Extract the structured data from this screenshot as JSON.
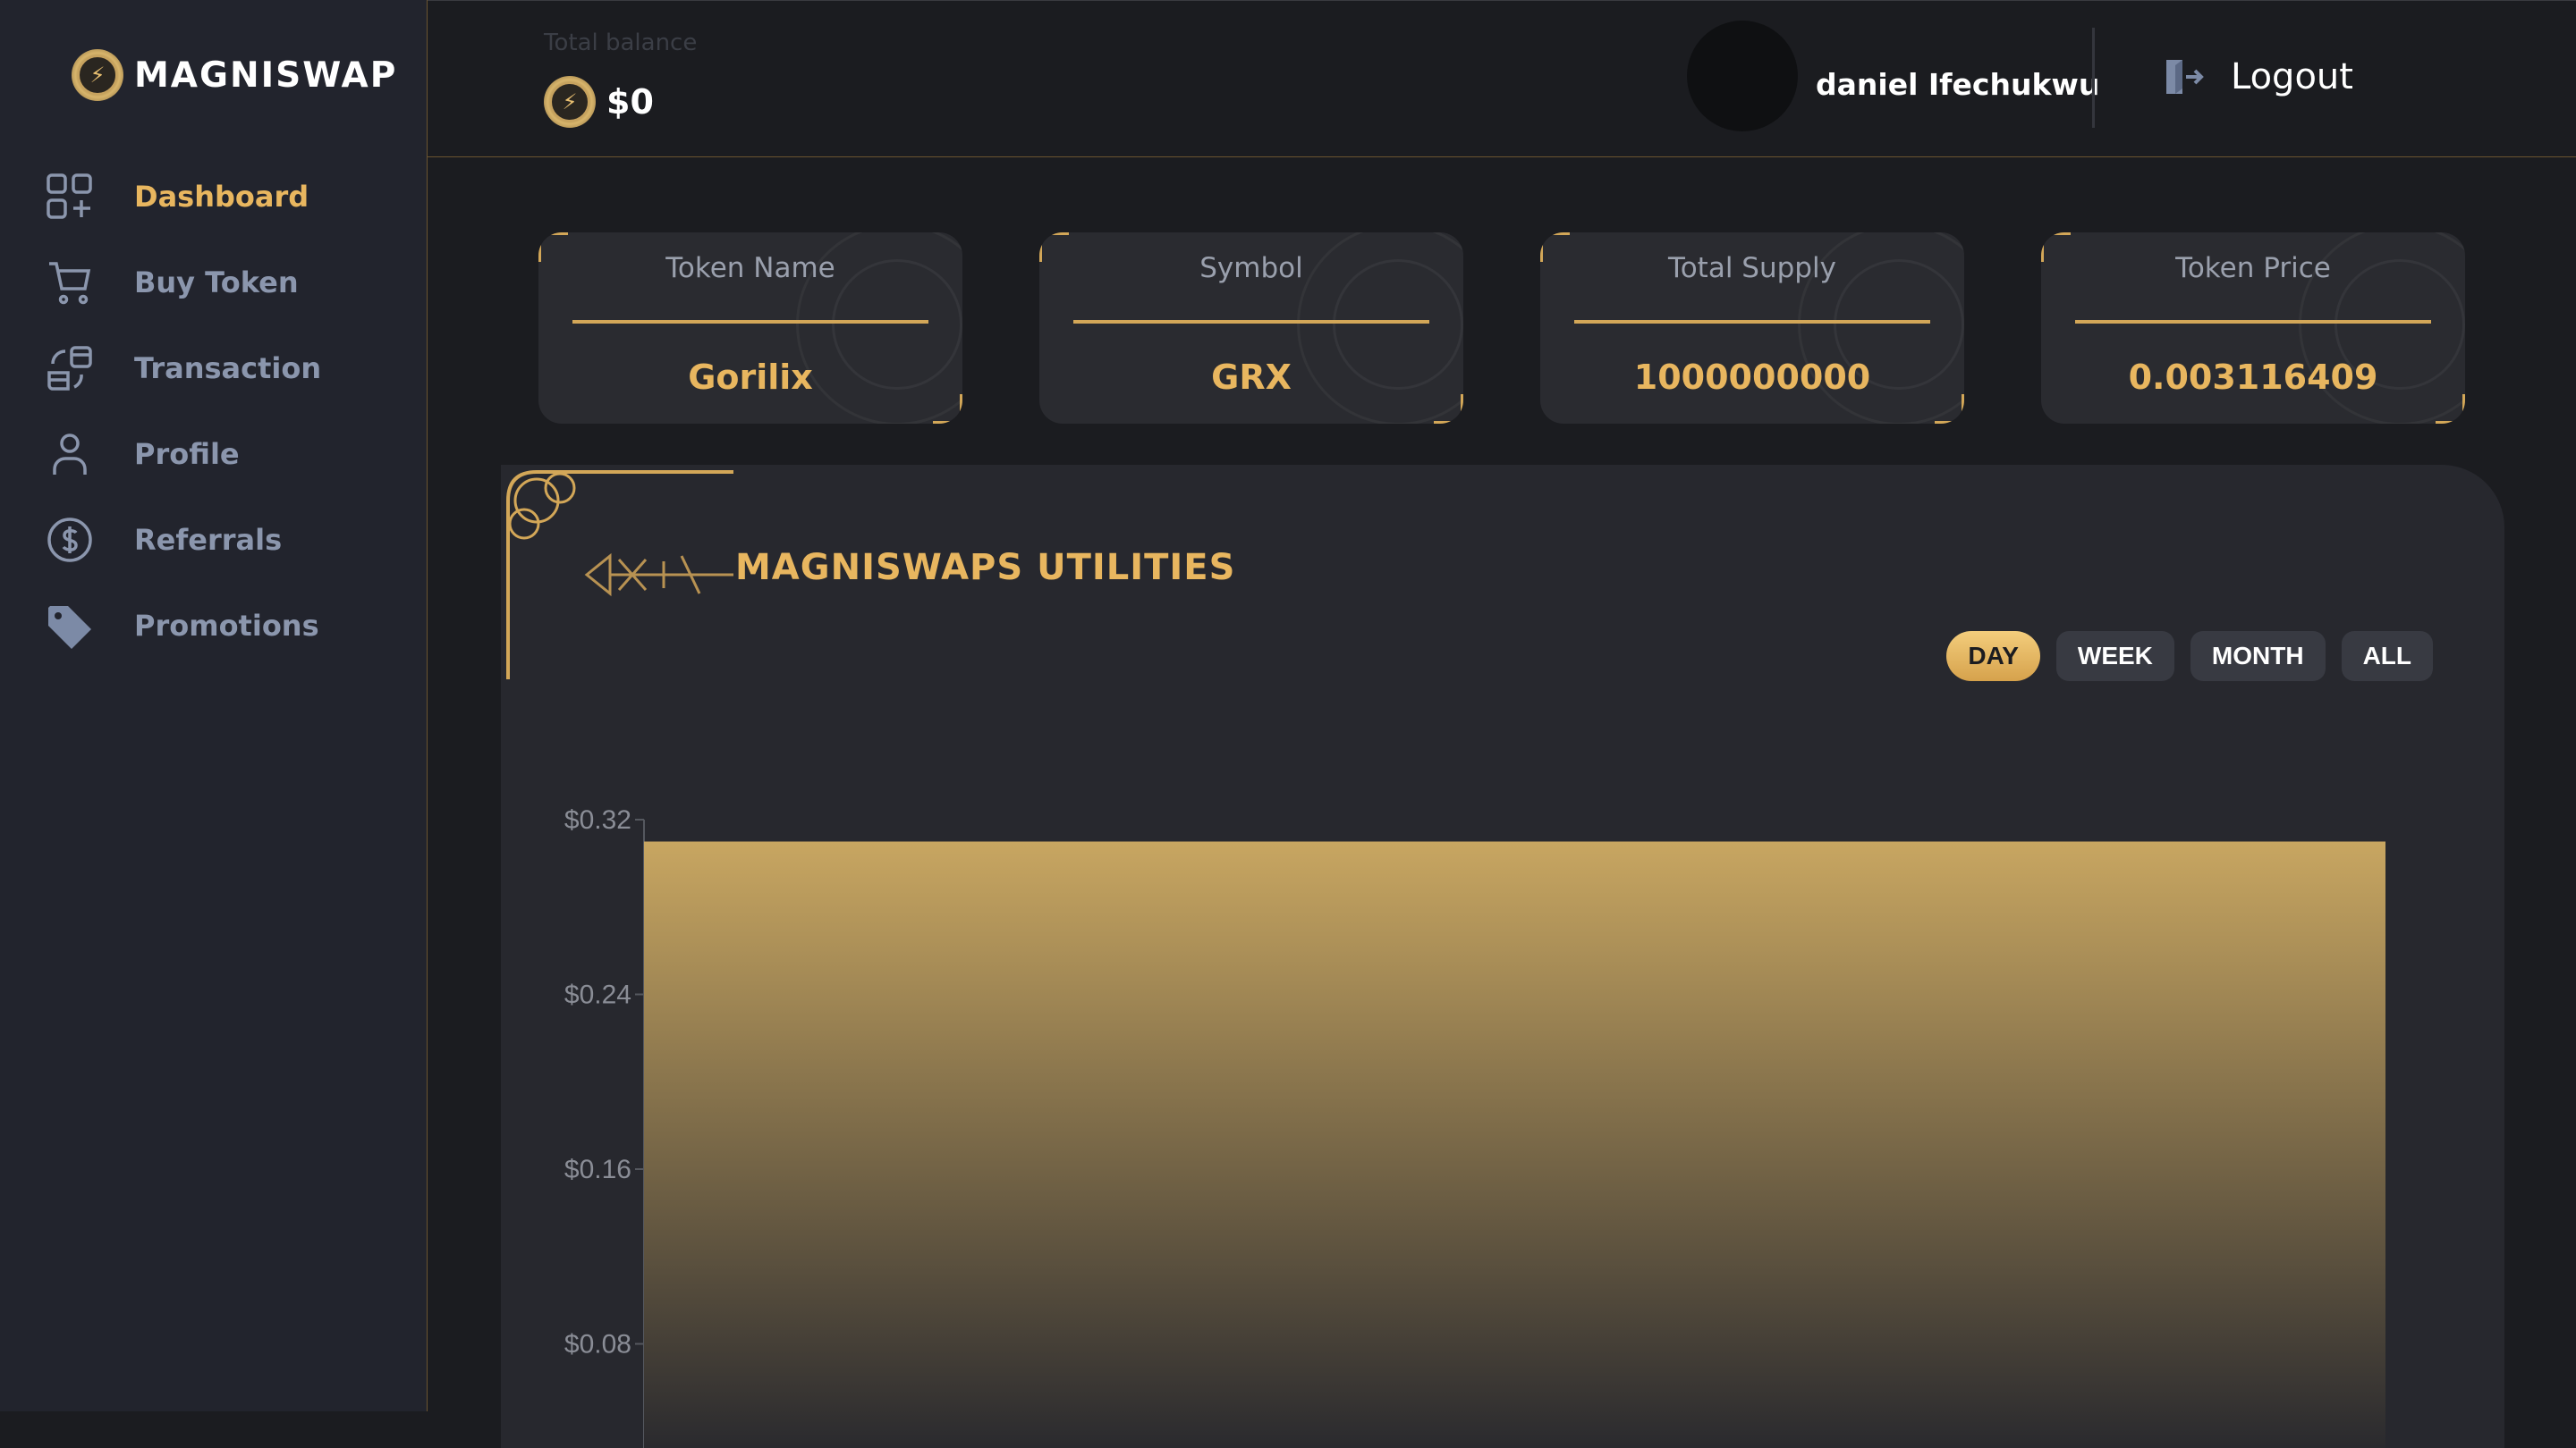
{
  "app": {
    "name": "MAGNISWAP"
  },
  "sidebar": {
    "items": [
      {
        "label": "Dashboard",
        "icon": "dashboard-icon",
        "active": true
      },
      {
        "label": "Buy Token",
        "icon": "cart-icon"
      },
      {
        "label": "Transaction",
        "icon": "transaction-icon"
      },
      {
        "label": "Profile",
        "icon": "user-icon"
      },
      {
        "label": "Referrals",
        "icon": "dollar-icon"
      },
      {
        "label": "Promotions",
        "icon": "tag-icon"
      }
    ]
  },
  "header": {
    "balance_label": "Total balance",
    "balance_value": "$0",
    "username": "daniel Ifechukwu",
    "logout_label": "Logout"
  },
  "stats": [
    {
      "label": "Token Name",
      "value": "Gorilix"
    },
    {
      "label": "Symbol",
      "value": "GRX"
    },
    {
      "label": "Total Supply",
      "value": "1000000000"
    },
    {
      "label": "Token Price",
      "value": "0.003116409"
    }
  ],
  "panel": {
    "title": "MAGNISWAPS UTILITIES",
    "filters": [
      "DAY",
      "WEEK",
      "MONTH",
      "ALL"
    ],
    "active_filter": "DAY"
  },
  "colors": {
    "accent": "#e8b65f",
    "background": "#1b1c20",
    "sidebar": "#22242d",
    "card": "#2a2b30"
  },
  "chart_data": {
    "type": "area",
    "series": [
      {
        "values": [
          0.31,
          0.31
        ]
      }
    ],
    "x": [
      0,
      1
    ],
    "yticks": [
      "$0.32",
      "$0.24",
      "$0.16",
      "$0.08"
    ],
    "ytick_values": [
      0.32,
      0.24,
      0.16,
      0.08
    ],
    "ylim": [
      0,
      0.32
    ]
  }
}
